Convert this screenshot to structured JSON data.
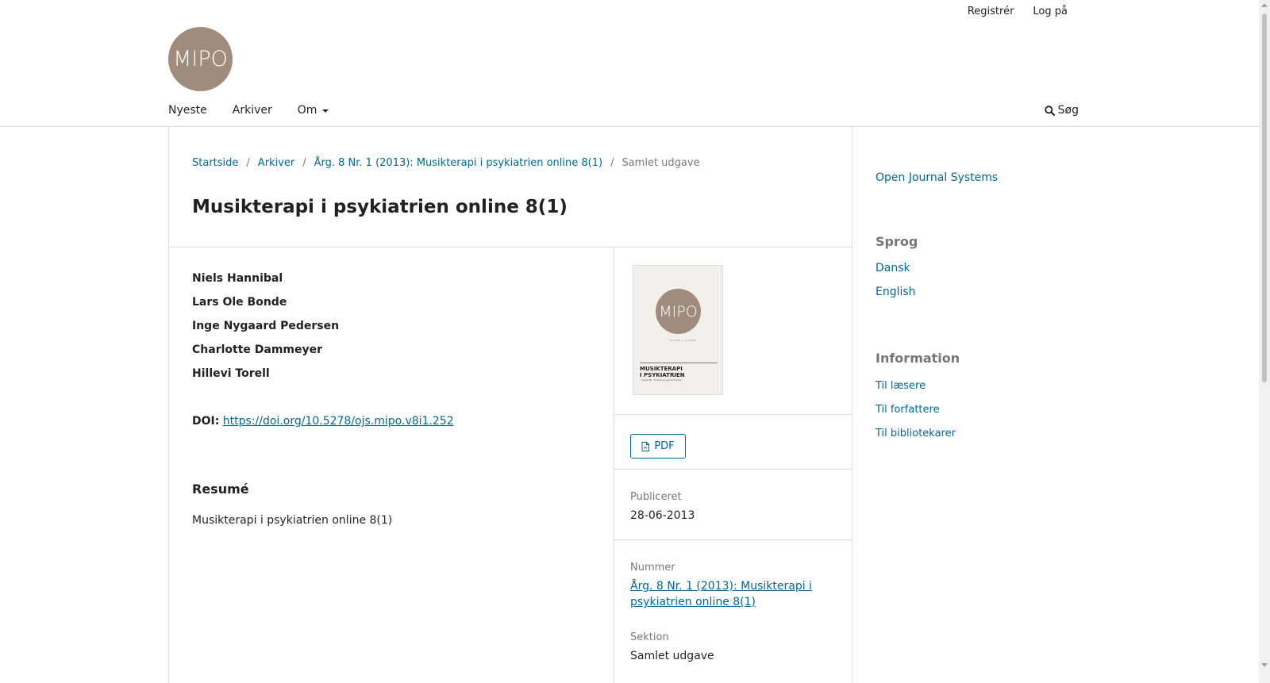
{
  "user_nav": {
    "register": "Registrér",
    "login": "Log på"
  },
  "logo": {
    "text": "MIPO"
  },
  "primary_nav": {
    "items": [
      "Nyeste",
      "Arkiver",
      "Om"
    ]
  },
  "search": {
    "label": "Søg"
  },
  "breadcrumbs": {
    "home": "Startside",
    "archives": "Arkiver",
    "issue": "Årg. 8 Nr. 1 (2013): Musikterapi i psykiatrien online 8(1)",
    "current": "Samlet udgave",
    "separator": "/"
  },
  "article": {
    "title": "Musikterapi i psykiatrien online 8(1)",
    "authors": [
      "Niels Hannibal",
      "Lars Ole Bonde",
      "Inge Nygaard Pedersen",
      "Charlotte Dammeyer",
      "Hillevi Torell"
    ],
    "doi_label": "DOI:",
    "doi_url": "https://doi.org/10.5278/ojs.mipo.v8i1.252",
    "abstract_title": "Resumé",
    "abstract_text": "Musikterapi i psykiatrien online 8(1)"
  },
  "cover": {
    "logo_text": "MIPO",
    "small_text": "Vol. 8 Nr. 1 · juni 2013",
    "title_line1": "MUSIKTERAPI",
    "title_line2": "I PSYKIATRIEN",
    "subtitle": "– Årsskrift · forskning og formidling"
  },
  "details": {
    "pdf_label": "PDF",
    "published_label": "Publiceret",
    "published_value": "28-06-2013",
    "issue_label": "Nummer",
    "issue_value": "Årg. 8 Nr. 1 (2013): Musikterapi i psykiatrien online 8(1)",
    "section_label": "Sektion",
    "section_value": "Samlet udgave"
  },
  "sidebar": {
    "ojs": "Open Journal Systems",
    "language_title": "Sprog",
    "languages": [
      "Dansk",
      "English"
    ],
    "info_title": "Information",
    "info_links": [
      "Til læsere",
      "Til forfattere",
      "Til bibliotekarer"
    ]
  },
  "colors": {
    "link": "#006798",
    "logo_bg": "#a08c7d",
    "rule": "#dddddd"
  }
}
